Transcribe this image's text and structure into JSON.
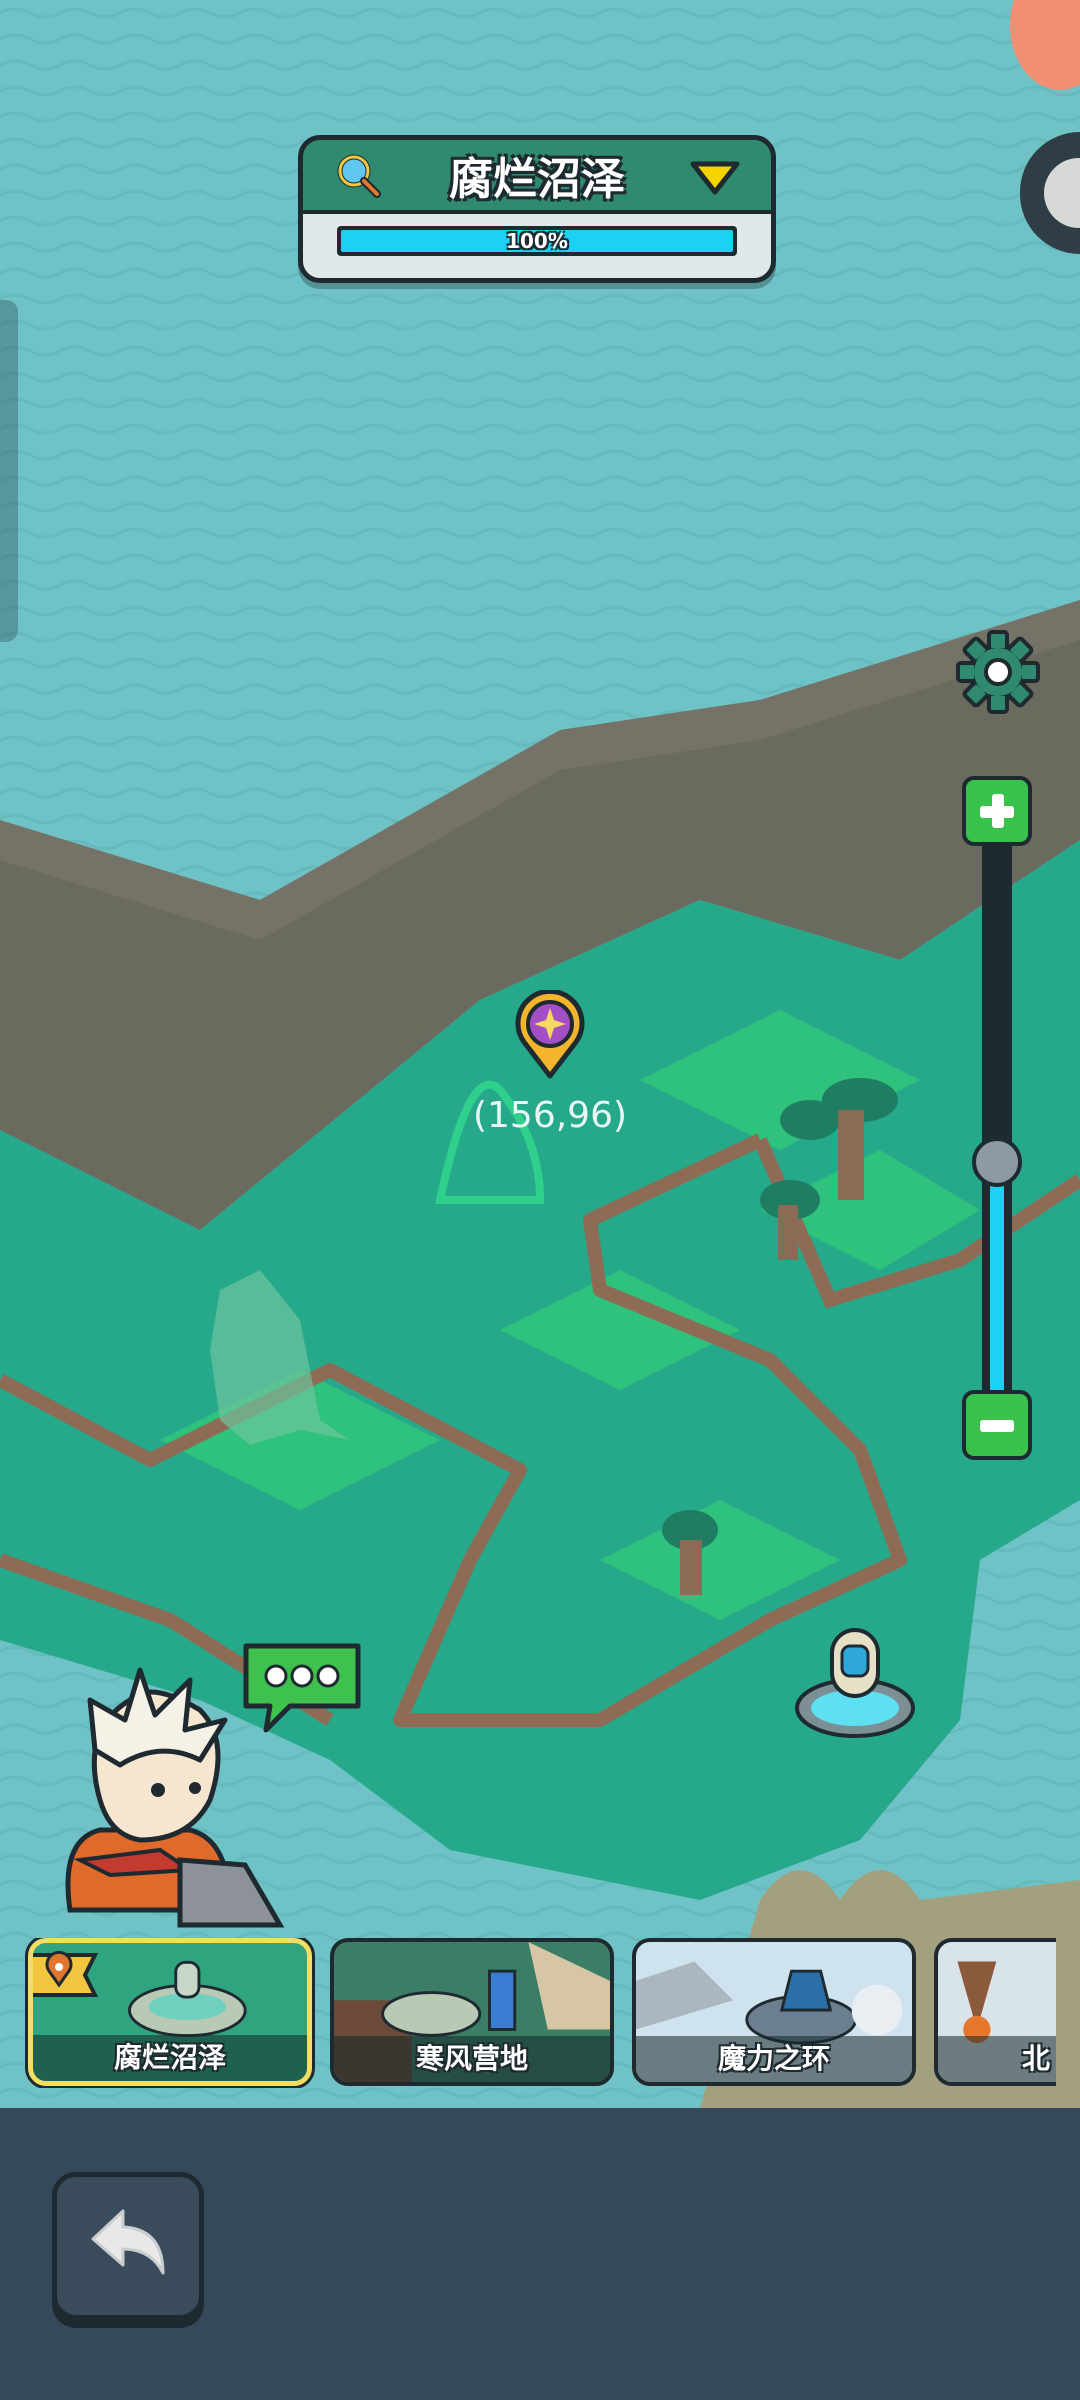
{
  "region": {
    "name": "腐烂沼泽",
    "progress_text": "100%",
    "progress_value": 1.0
  },
  "map": {
    "coordinate": "(156,96)",
    "zoom_level": 0.42
  },
  "map_cards": [
    {
      "label": "腐烂沼泽",
      "selected": true
    },
    {
      "label": "寒风营地",
      "selected": false
    },
    {
      "label": "魔力之环",
      "selected": false
    },
    {
      "label": "北",
      "selected": false
    }
  ],
  "icons": {
    "search": "magnifier-icon",
    "dropdown": "triangle-down-icon",
    "settings": "gear-icon",
    "zoom_in": "plus-icon",
    "zoom_out": "minus-icon",
    "location": "location-pin-icon",
    "portal": "portal-icon",
    "chat": "chat-bubble-icon",
    "back": "back-arrow-icon"
  },
  "colors": {
    "header_green": "#2f8a6f",
    "progress": "#1fd0f5",
    "selected_card_border": "#f3dd62",
    "bottom_bar": "#36495a"
  }
}
